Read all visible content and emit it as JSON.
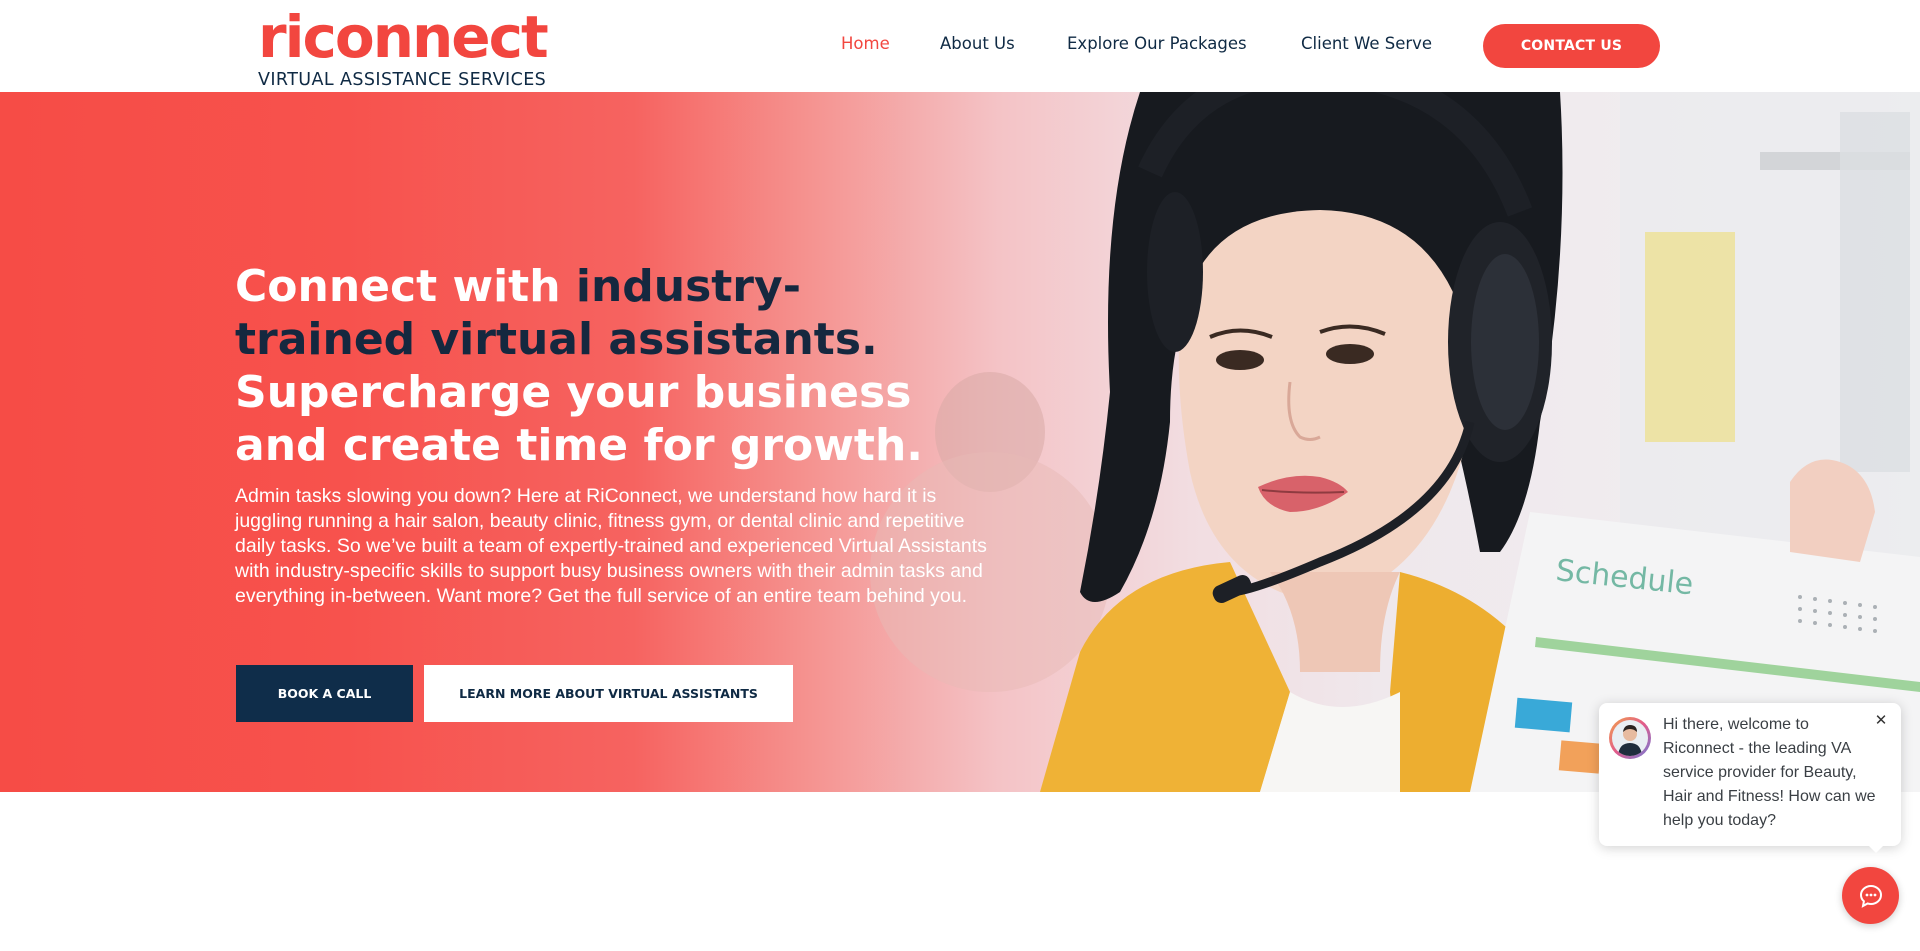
{
  "brand": {
    "logo_word": "riconnect",
    "logo_tagline": "VIRTUAL ASSISTANCE SERVICES",
    "accent_color": "#f2463f",
    "dark_color": "#0f2a44"
  },
  "nav": {
    "items": [
      {
        "label": "Home",
        "active": true
      },
      {
        "label": "About Us",
        "active": false
      },
      {
        "label": "Explore Our Packages",
        "active": false
      },
      {
        "label": "Client We Serve",
        "active": false
      }
    ],
    "contact_label": "CONTACT US"
  },
  "hero": {
    "title_part1": "Connect with ",
    "title_part2": "industry-trained virtual assistants.",
    "title_part3": " Supercharge your business and create time for growth.",
    "body": "Admin tasks slowing you down? Here at RiConnect, we understand how hard it is juggling running a hair salon, beauty clinic, fitness gym, or dental clinic and repetitive daily tasks. So we’ve built a team of expertly-trained and experienced Virtual Assistants with industry-specific skills to support busy business owners with their admin tasks and everything in-between. Want more? Get the full service of an entire team behind you.",
    "book_label": "BOOK A CALL",
    "learn_label": "LEARN MORE ABOUT VIRTUAL ASSISTANTS",
    "photo_text": "Schedule"
  },
  "chat": {
    "message": "Hi there, welcome to Riconnect - the leading VA service provider for Beauty, Hair and Fitness! How can we help you today?",
    "close_symbol": "✕",
    "launcher_icon": "chat-icon"
  }
}
